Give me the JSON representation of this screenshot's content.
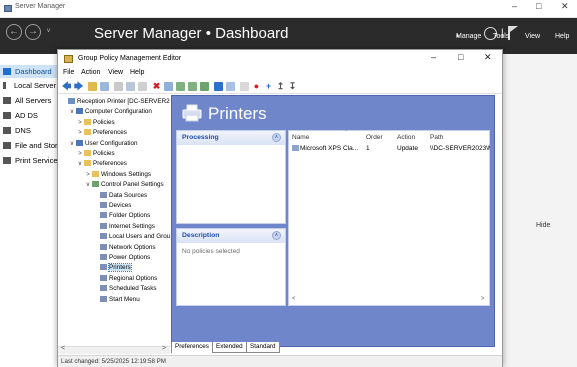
{
  "server_manager": {
    "window_title": "Server Manager",
    "header_title": "Server Manager • Dashboard",
    "menu": [
      "Manage",
      "Tools",
      "View",
      "Help"
    ],
    "sidebar": [
      {
        "label": "Dashboard",
        "icon": "dashboard-icon",
        "active": true
      },
      {
        "label": "Local Server",
        "icon": "server-icon",
        "active": false
      },
      {
        "label": "All Servers",
        "icon": "servers-icon",
        "active": false
      },
      {
        "label": "AD DS",
        "icon": "ad-ds-icon",
        "active": false
      },
      {
        "label": "DNS",
        "icon": "dns-icon",
        "active": false
      },
      {
        "label": "File and Storage Services",
        "icon": "file-storage-icon",
        "active": false
      },
      {
        "label": "Print Services",
        "icon": "printer-icon",
        "active": false
      }
    ],
    "hide_label": "Hide"
  },
  "gpme": {
    "window_title": "Group Policy Management Editor",
    "menu": [
      "File",
      "Action",
      "View",
      "Help"
    ],
    "tree": [
      {
        "label": "Reception Printer [DC-SERVER2023.",
        "indent": 0,
        "twisty": "",
        "icon": "gpo-icon"
      },
      {
        "label": "Computer Configuration",
        "indent": 1,
        "twisty": "∨",
        "icon": "computer-icon"
      },
      {
        "label": "Policies",
        "indent": 2,
        "twisty": ">",
        "icon": "folder-icon"
      },
      {
        "label": "Preferences",
        "indent": 2,
        "twisty": ">",
        "icon": "folder-icon"
      },
      {
        "label": "User Configuration",
        "indent": 1,
        "twisty": "∨",
        "icon": "user-icon"
      },
      {
        "label": "Policies",
        "indent": 2,
        "twisty": ">",
        "icon": "folder-icon"
      },
      {
        "label": "Preferences",
        "indent": 2,
        "twisty": "∨",
        "icon": "folder-icon"
      },
      {
        "label": "Windows Settings",
        "indent": 3,
        "twisty": ">",
        "icon": "folder-icon"
      },
      {
        "label": "Control Panel Settings",
        "indent": 3,
        "twisty": "∨",
        "icon": "control-panel-icon"
      },
      {
        "label": "Data Sources",
        "indent": 4,
        "twisty": "",
        "icon": "data-sources-icon"
      },
      {
        "label": "Devices",
        "indent": 4,
        "twisty": "",
        "icon": "devices-icon"
      },
      {
        "label": "Folder Options",
        "indent": 4,
        "twisty": "",
        "icon": "folder-options-icon"
      },
      {
        "label": "Internet Settings",
        "indent": 4,
        "twisty": "",
        "icon": "internet-settings-icon"
      },
      {
        "label": "Local Users and Groups",
        "indent": 4,
        "twisty": "",
        "icon": "local-users-icon"
      },
      {
        "label": "Network Options",
        "indent": 4,
        "twisty": "",
        "icon": "network-options-icon"
      },
      {
        "label": "Power Options",
        "indent": 4,
        "twisty": "",
        "icon": "power-options-icon"
      },
      {
        "label": "Printers",
        "indent": 4,
        "twisty": "",
        "icon": "printers-icon",
        "selected": true
      },
      {
        "label": "Regional Options",
        "indent": 4,
        "twisty": "",
        "icon": "regional-options-icon"
      },
      {
        "label": "Scheduled Tasks",
        "indent": 4,
        "twisty": "",
        "icon": "scheduled-tasks-icon"
      },
      {
        "label": "Start Menu",
        "indent": 4,
        "twisty": "",
        "icon": "start-menu-icon"
      }
    ],
    "pane_title": "Printers",
    "processing_title": "Processing",
    "description_title": "Description",
    "description_text": "No policies selected",
    "columns": [
      "Name",
      "Order",
      "Action",
      "Path"
    ],
    "rows": [
      {
        "name": "Microsoft XPS Cla...",
        "order": "1",
        "action": "Update",
        "path": "\\\\DC-SERVER2023\\Mi"
      }
    ],
    "tabs": [
      "Preferences",
      "Extended",
      "Standard"
    ],
    "status": "Last changed: 5/25/2025 12:19:58 PM"
  },
  "colors": {
    "sm_header": "#2b2b2b",
    "pane_blue": "#6f86cb",
    "card_title_text": "#1f4db0"
  }
}
